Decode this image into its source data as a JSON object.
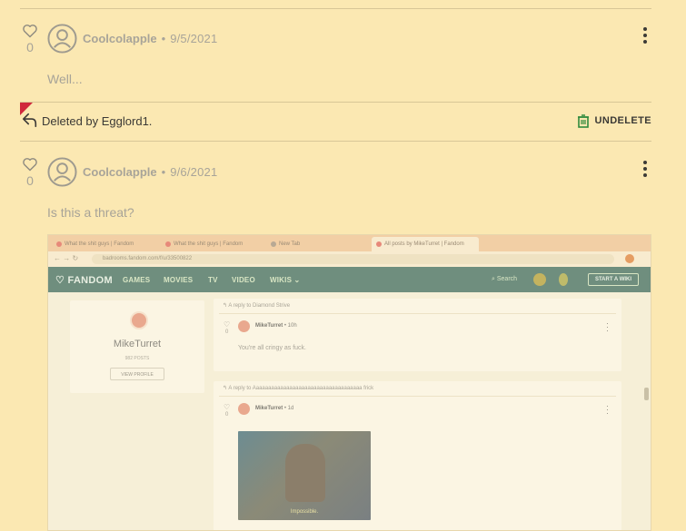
{
  "comments": [
    {
      "author": "Coolcolapple",
      "sep": "•",
      "date": "9/5/2021",
      "likes": "0",
      "body": "Well..."
    },
    {
      "author": "Coolcolapple",
      "sep": "•",
      "date": "9/6/2021",
      "likes": "0",
      "body": "Is this a threat?"
    }
  ],
  "deleted": {
    "text": "Deleted by Egglord1.",
    "undelete_label": "UNDELETE"
  },
  "colors": {
    "background": "#fbe8b2",
    "flag": "#d0283b",
    "undelete_icon": "#2f8a3c"
  },
  "embedded_screenshot": {
    "tabs": [
      "What the shit guys | Fandom",
      "What the shit guys | Fandom",
      "New Tab",
      "All posts by MikeTurret | Fandom"
    ],
    "url": "badrooms.fandom.com/f/u/33500822",
    "nav": {
      "logo": "FANDOM",
      "items": [
        "GAMES",
        "MOVIES",
        "TV",
        "VIDEO",
        "WIKIS ⌄"
      ],
      "search": "Search",
      "start_wiki": "START A WIKI"
    },
    "profile": {
      "name": "MikeTurret",
      "posts": "982 POSTS",
      "view_profile": "VIEW PROFILE"
    },
    "posts": [
      {
        "reply_to": "A reply to Diamond Strive",
        "user": "MikeTurret",
        "time": "10h",
        "likes": "0",
        "body": "You're all cringy as fuck."
      },
      {
        "reply_to": "A reply to Aaaaaaaaaaaaaaaaaaaaaaaaaaaaaaaaaaaa frick",
        "user": "MikeTurret",
        "time": "1d",
        "likes": "0",
        "gif_caption": "Impossible."
      }
    ]
  }
}
